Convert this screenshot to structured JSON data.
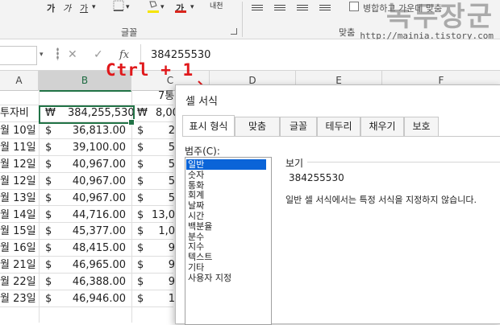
{
  "ribbon": {
    "bold": "가",
    "italic": "가",
    "underline": "가",
    "underline_arrow": "▾",
    "border_arrow": "▾",
    "fill_arrow": "▾",
    "font_color_glyph": "가",
    "font_color_arrow": "▾",
    "phonetic_glyph": "내천",
    "font_group_label": "글꼴",
    "merge_center_label": "병합하고 가운데 맞춤",
    "alignment_group_label": "맞춤",
    "fill_color": "#f5e400",
    "font_color": "#d9251c"
  },
  "watermark": {
    "title": "녹두장군",
    "url": "http://mainia.tistory.com"
  },
  "formula_bar": {
    "name_box_arrow": "▾",
    "cancel_icon": "✕",
    "enter_icon": "✓",
    "fx_label": "fx",
    "value": "384255530"
  },
  "grid": {
    "columns": [
      "A",
      "B",
      "C",
      "D",
      "E",
      "F"
    ],
    "selected_column": "B",
    "c_header_partial": "7통",
    "a_header_partial": "투자비",
    "b_header_currency": "₩",
    "b_header_value": "384,255,530",
    "c_header_currency": "₩",
    "c_header_value": "8,00",
    "rows": [
      {
        "date": "월 10일",
        "b": "36,813.00",
        "c": "2"
      },
      {
        "date": "월 11일",
        "b": "39,100.00",
        "c": "5"
      },
      {
        "date": "월 12일",
        "b": "40,967.00",
        "c": "5"
      },
      {
        "date": "월 12일",
        "b": "40,967.00",
        "c": "5"
      },
      {
        "date": "월 13일",
        "b": "40,967.00",
        "c": "5"
      },
      {
        "date": "월 14일",
        "b": "44,716.00",
        "c": "13,0"
      },
      {
        "date": "월 15일",
        "b": "45,377.00",
        "c": "1,0"
      },
      {
        "date": "월 16일",
        "b": "48,415.00",
        "c": "9"
      },
      {
        "date": "월 21일",
        "b": "46,965.00",
        "c": "9"
      },
      {
        "date": "월 22일",
        "b": "46,388.00",
        "c": "9"
      },
      {
        "date": "월 23일",
        "b": "46,946.00",
        "c": "1"
      }
    ],
    "dollar": "$"
  },
  "annotation": {
    "shortcut": "Ctrl + 1",
    "color": "#e0181b"
  },
  "dialog": {
    "title": "셀 서식",
    "tabs": [
      "표시 형식",
      "맞춤",
      "글꼴",
      "테두리",
      "채우기",
      "보호"
    ],
    "active_tab": "표시 형식",
    "category_label": "범주(C):",
    "categories": [
      "일반",
      "숫자",
      "통화",
      "회계",
      "날짜",
      "시간",
      "백분율",
      "분수",
      "지수",
      "텍스트",
      "기타",
      "사용자 지정"
    ],
    "selected_category": "일반",
    "sample_label": "보기",
    "sample_value": "384255530",
    "description": "일반 셀 서식에서는 특정 서식을 지정하지 않습니다."
  }
}
